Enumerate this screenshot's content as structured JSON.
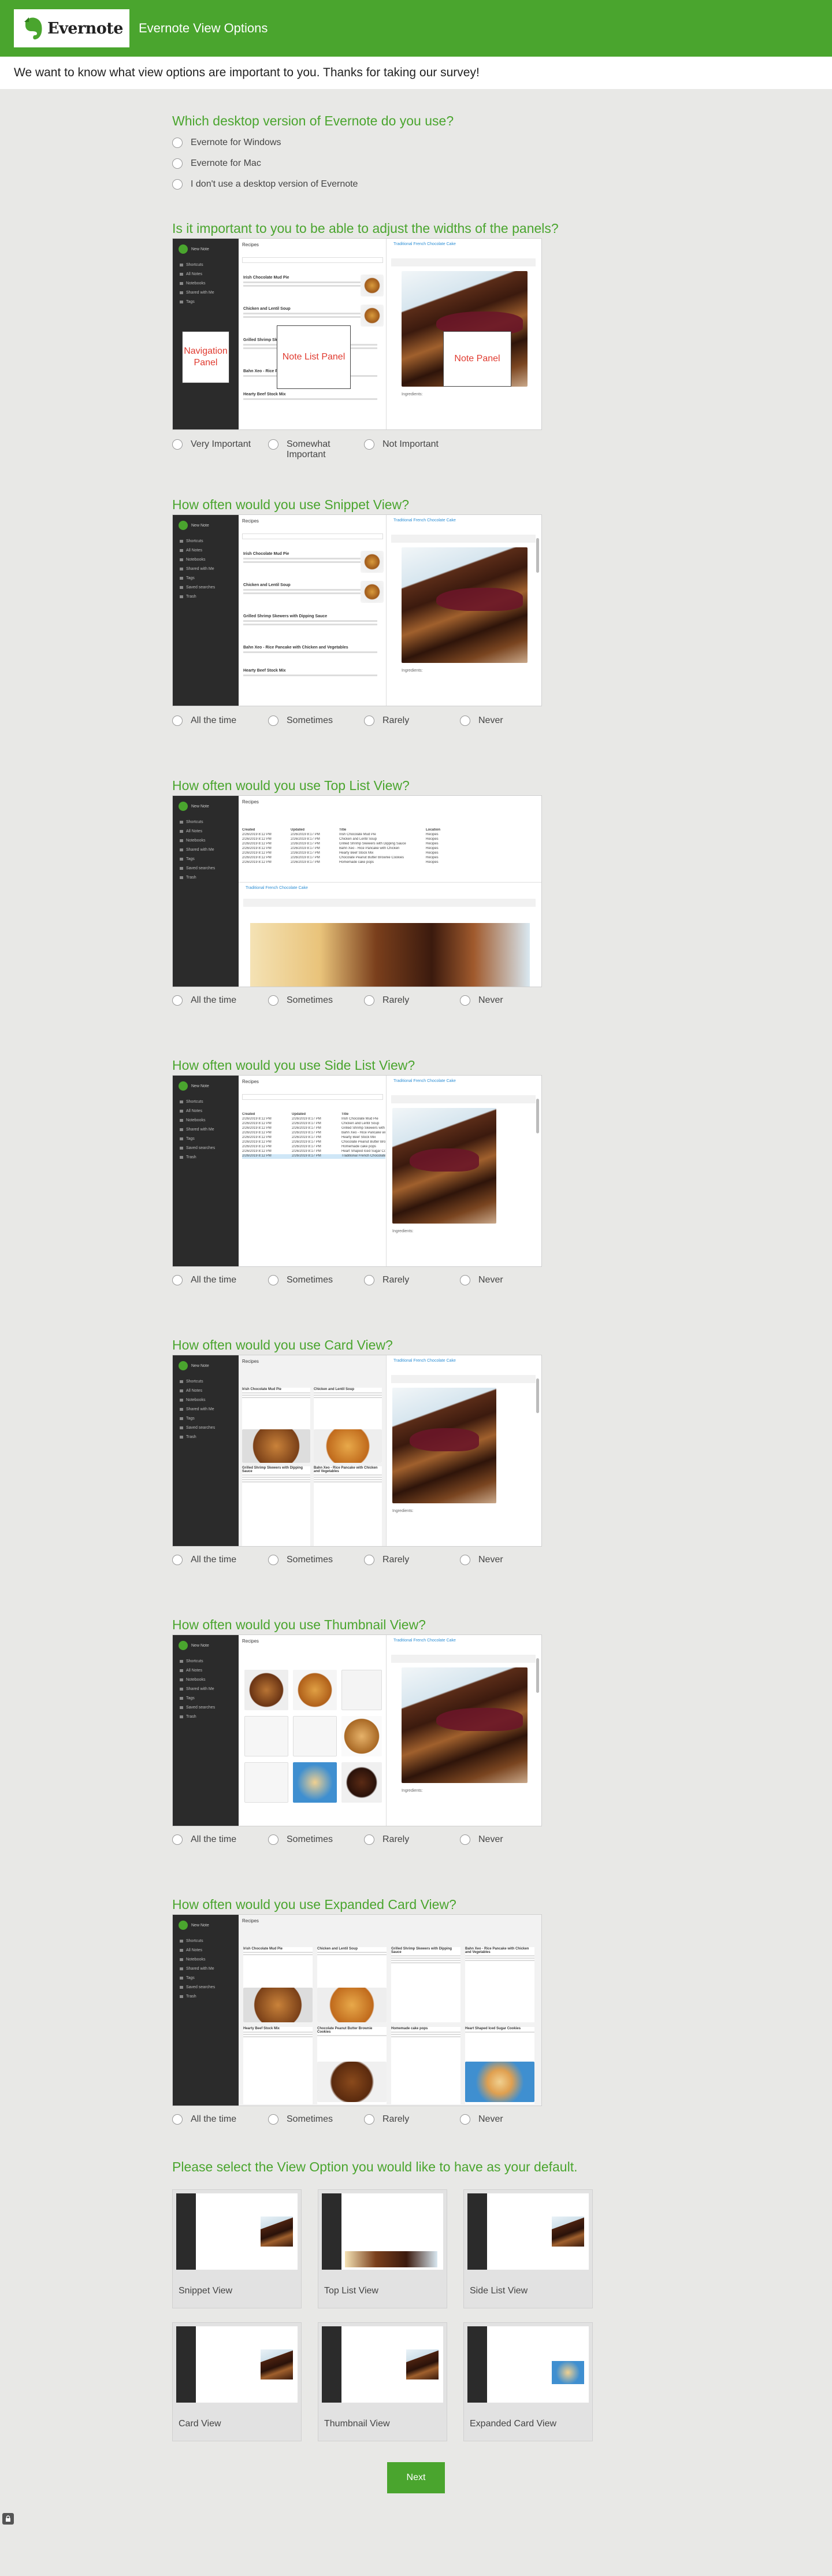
{
  "header": {
    "logo_text": "Evernote",
    "title": "Evernote View Options"
  },
  "intro": "We want to know what view options are important to you.  Thanks for taking our survey!",
  "q1": {
    "title": "Which desktop version of Evernote do you use?",
    "options": [
      "Evernote for Windows",
      "Evernote for Mac",
      "I don't use a desktop version of Evernote"
    ]
  },
  "q2": {
    "title": "Is it important to you to be able to adjust the widths of the panels?",
    "labels": {
      "nav": "Navigation Panel",
      "list": "Note List Panel",
      "note": "Note Panel"
    },
    "options": [
      "Very Important",
      "Somewhat Important",
      "Not Important"
    ]
  },
  "freq_options": [
    "All the time",
    "Sometimes",
    "Rarely",
    "Never"
  ],
  "q3": {
    "title": "How often would you use Snippet View?"
  },
  "q4": {
    "title": "How often would you use Top List View?"
  },
  "q5": {
    "title": "How often would you use Side List View?"
  },
  "q6": {
    "title": "How often would you use Card View?"
  },
  "q7": {
    "title": "How often would you use Thumbnail View?"
  },
  "q8": {
    "title": "How often would you use Expanded Card View?"
  },
  "q9": {
    "title": "Please select the View Option you would like to have as your default.",
    "tiles": [
      "Snippet View",
      "Top List View",
      "Side List View",
      "Card View",
      "Thumbnail View",
      "Expanded Card View"
    ]
  },
  "mock": {
    "new_note": "New Note",
    "sidebar": [
      "Shortcuts",
      "All Notes",
      "Notebooks",
      "Shared with Me",
      "Tags",
      "Saved searches",
      "Trash"
    ],
    "notebook": "Recipes",
    "note_title": "Traditional French Chocolate Cake",
    "caption": "Ingredients:",
    "notes": [
      "Irish Chocolate Mud Pie",
      "Chicken and Lentil Soup",
      "Grilled Shrimp Skewers with Dipping Sauce",
      "Bahn Xeo - Rice Pancake with Chicken and Vegetables",
      "Hearty Beef Stock Mix"
    ],
    "table_head": [
      "Created",
      "Updated",
      "Title",
      "Location"
    ],
    "table_rows": [
      [
        "2/26/2019 8:12 PM",
        "2/26/2019 8:17 PM",
        "Irish Chocolate Mud Pie",
        "Recipes"
      ],
      [
        "2/26/2019 8:12 PM",
        "2/26/2019 8:17 PM",
        "Chicken and Lentil Soup",
        "Recipes"
      ],
      [
        "2/26/2019 8:12 PM",
        "2/26/2019 8:17 PM",
        "Grilled Shrimp Skewers with Dipping Sauce",
        "Recipes"
      ],
      [
        "2/26/2019 8:12 PM",
        "2/26/2019 8:17 PM",
        "Bahn Xeo - Rice Pancake with Chicken",
        "Recipes"
      ],
      [
        "2/26/2019 8:12 PM",
        "2/26/2019 8:17 PM",
        "Hearty Beef Stock Mix",
        "Recipes"
      ],
      [
        "2/26/2019 8:12 PM",
        "2/26/2019 8:17 PM",
        "Chocolate Peanut Butter Brownie Cookies",
        "Recipes"
      ],
      [
        "2/26/2019 8:12 PM",
        "2/26/2019 8:17 PM",
        "Homemade cake pops",
        "Recipes"
      ],
      [
        "2/26/2019 8:12 PM",
        "2/26/2019 8:17 PM",
        "Heart Shaped Iced Sugar Cookies",
        "Recipes"
      ],
      [
        "2/26/2019 8:12 PM",
        "2/26/2019 8:17 PM",
        "Traditional French Chocolate Cake",
        "Recipes"
      ]
    ]
  },
  "next_label": "Next",
  "colors": {
    "brand": "#4aa52e",
    "label_red": "#e03a2f",
    "link_blue": "#2d8fd5"
  }
}
